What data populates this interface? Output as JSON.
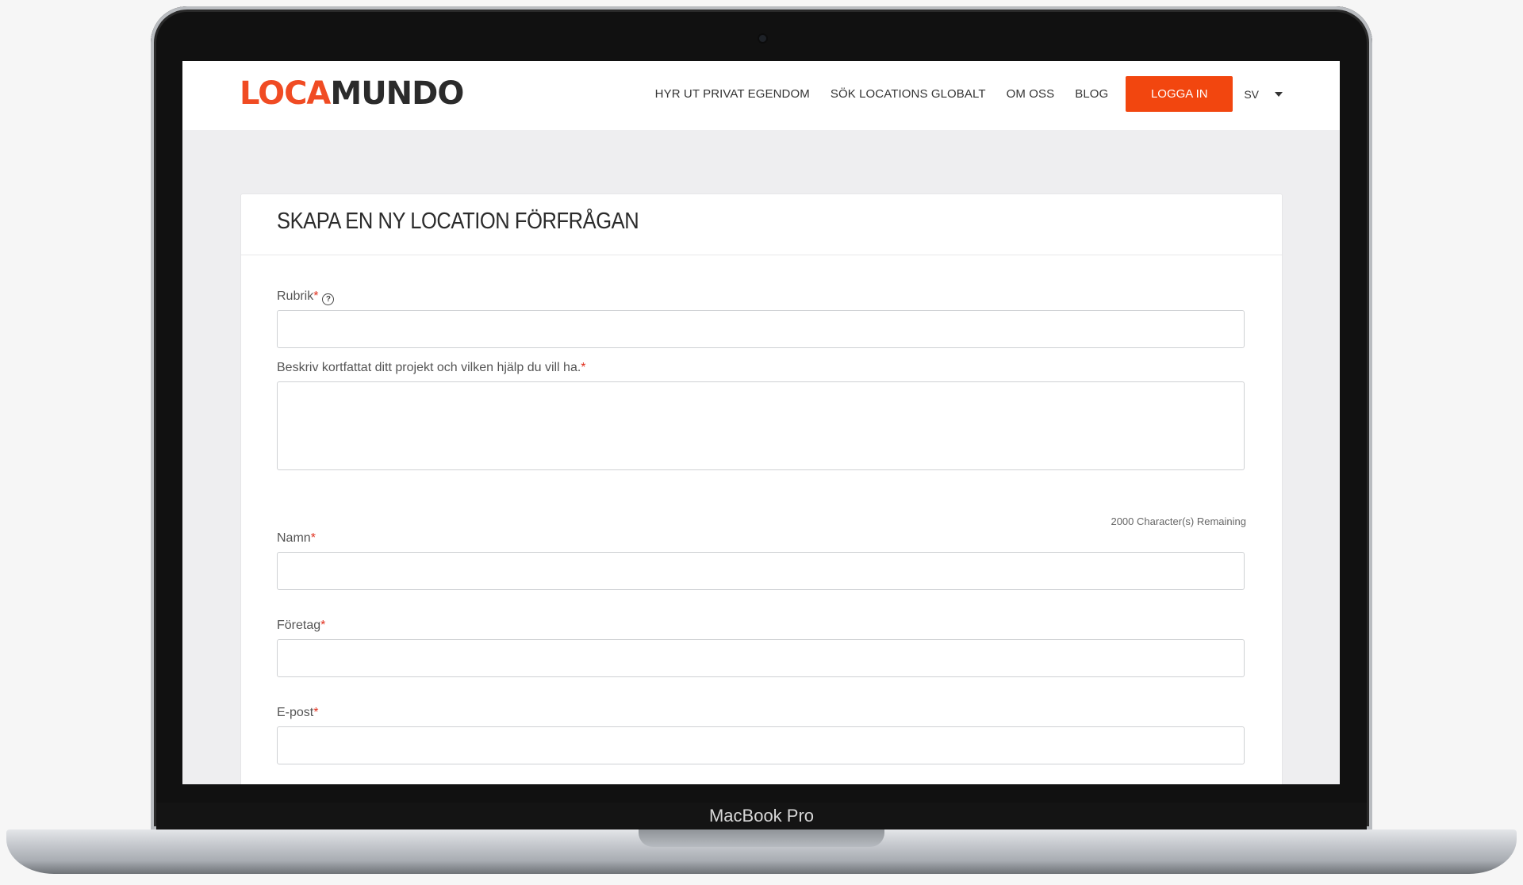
{
  "device": {
    "model_label": "MacBook Pro"
  },
  "header": {
    "logo_part1": "LOCA",
    "logo_part2": "MUNDO",
    "nav": [
      "HYR UT PRIVAT EGENDOM",
      "SÖK LOCATIONS GLOBALT",
      "OM OSS",
      "BLOG"
    ],
    "login_label": "LOGGA IN",
    "language": "SV"
  },
  "form": {
    "title": "SKAPA EN NY LOCATION FÖRFRÅGAN",
    "required_mark": "*",
    "help_glyph": "?",
    "fields": [
      {
        "label": "Rubrik",
        "value": ""
      },
      {
        "label": "Beskriv kortfattat ditt projekt och vilken hjälp du vill ha.",
        "value": ""
      },
      {
        "label": "Namn",
        "value": ""
      },
      {
        "label": "Företag",
        "value": ""
      },
      {
        "label": "E-post",
        "value": ""
      }
    ],
    "remaining_text": "2000 Character(s) Remaining"
  },
  "colors": {
    "accent": "#f2460f",
    "logo_dark": "#2b2b2b",
    "required": "#e0301e"
  }
}
